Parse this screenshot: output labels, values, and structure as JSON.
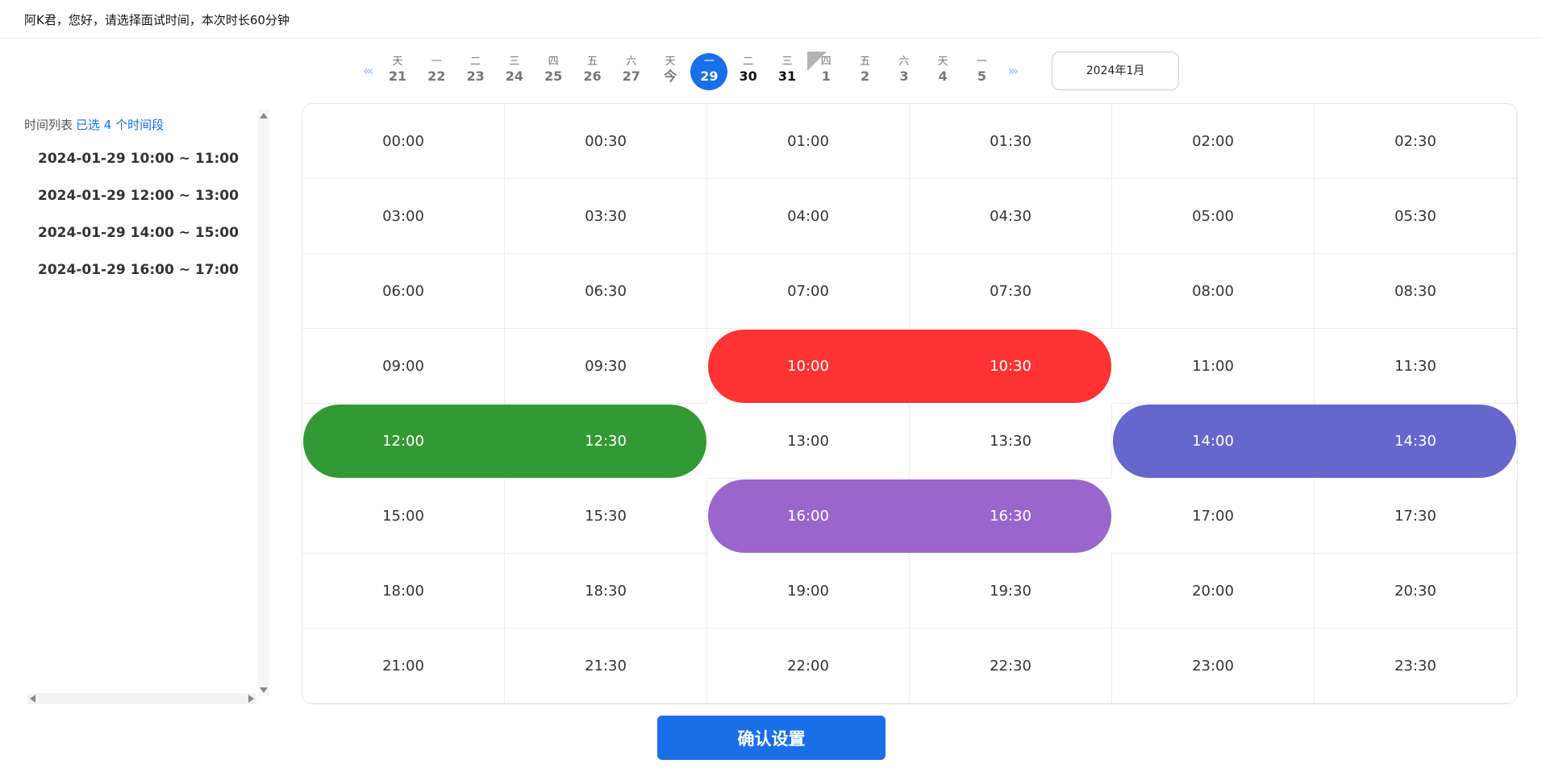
{
  "header": {
    "greeting": "阿K君，您好，请选择面试时间，本次时长60分钟"
  },
  "date_strip": {
    "prev_label": "«‹",
    "next_label": "›»",
    "days": [
      {
        "weekday": "天",
        "date": "21"
      },
      {
        "weekday": "一",
        "date": "22"
      },
      {
        "weekday": "二",
        "date": "23"
      },
      {
        "weekday": "三",
        "date": "24"
      },
      {
        "weekday": "四",
        "date": "25"
      },
      {
        "weekday": "五",
        "date": "26"
      },
      {
        "weekday": "六",
        "date": "27"
      },
      {
        "weekday": "天",
        "date": "今"
      },
      {
        "weekday": "一",
        "date": "29",
        "selected": true
      },
      {
        "weekday": "二",
        "date": "30",
        "bold": true
      },
      {
        "weekday": "三",
        "date": "31",
        "bold": true
      },
      {
        "weekday": "四",
        "date": "1",
        "marked": true
      },
      {
        "weekday": "五",
        "date": "2"
      },
      {
        "weekday": "六",
        "date": "3"
      },
      {
        "weekday": "天",
        "date": "4"
      },
      {
        "weekday": "一",
        "date": "5"
      }
    ],
    "month_button": "2024年1月"
  },
  "side_panel": {
    "title": "时间列表",
    "count_text": "已选 4 个时间段",
    "slots": [
      "2024-01-29 10:00 ~ 11:00",
      "2024-01-29 12:00 ~ 13:00",
      "2024-01-29 14:00 ~ 15:00",
      "2024-01-29 16:00 ~ 17:00"
    ]
  },
  "grid": {
    "columns": 6,
    "times": [
      "00:00",
      "00:30",
      "01:00",
      "01:30",
      "02:00",
      "02:30",
      "03:00",
      "03:30",
      "04:00",
      "04:30",
      "05:00",
      "05:30",
      "06:00",
      "06:30",
      "07:00",
      "07:30",
      "08:00",
      "08:30",
      "09:00",
      "09:30",
      "10:00",
      "10:30",
      "11:00",
      "11:30",
      "12:00",
      "12:30",
      "13:00",
      "13:30",
      "14:00",
      "14:30",
      "15:00",
      "15:30",
      "16:00",
      "16:30",
      "17:00",
      "17:30",
      "18:00",
      "18:30",
      "19:00",
      "19:30",
      "20:00",
      "20:30",
      "21:00",
      "21:30",
      "22:00",
      "22:30",
      "23:00",
      "23:30"
    ],
    "selections": [
      {
        "start": "10:00",
        "end": "10:30",
        "color": "#ff3333"
      },
      {
        "start": "12:00",
        "end": "12:30",
        "color": "#339933"
      },
      {
        "start": "14:00",
        "end": "14:30",
        "color": "#6666cc"
      },
      {
        "start": "16:00",
        "end": "16:30",
        "color": "#9966cc"
      }
    ]
  },
  "confirm_button": "确认设置"
}
